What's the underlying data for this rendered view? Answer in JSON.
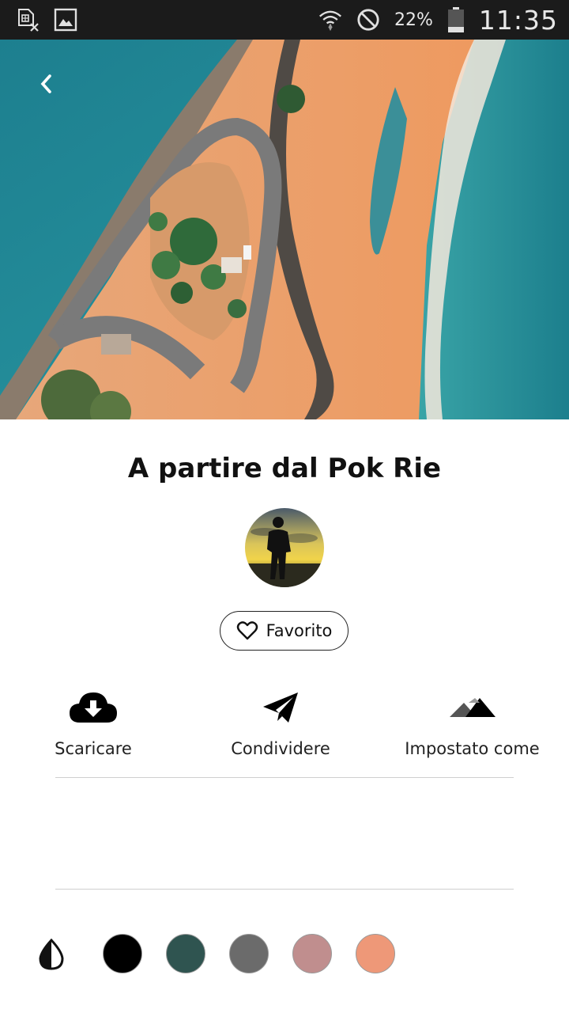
{
  "status_bar": {
    "battery_percent": "22%",
    "time": "11:35",
    "icons": [
      "sim-error-icon",
      "gallery-icon",
      "wifi-icon",
      "do-not-disturb-icon",
      "battery-icon"
    ]
  },
  "hero": {
    "back_icon": "back-chevron-icon"
  },
  "photo": {
    "title": "A partire dal Pok Rie"
  },
  "favorite": {
    "label": "Favorito",
    "icon": "heart-outline-icon"
  },
  "actions": [
    {
      "label": "Scaricare",
      "icon": "cloud-download-icon"
    },
    {
      "label": "Condividere",
      "icon": "paper-plane-icon"
    },
    {
      "label": "Impostato come",
      "icon": "mountains-icon"
    }
  ],
  "palette": {
    "icon": "color-drop-icon",
    "colors": [
      "#000000",
      "#2f5450",
      "#6b6b6b",
      "#c08e8e",
      "#ee9878"
    ]
  }
}
